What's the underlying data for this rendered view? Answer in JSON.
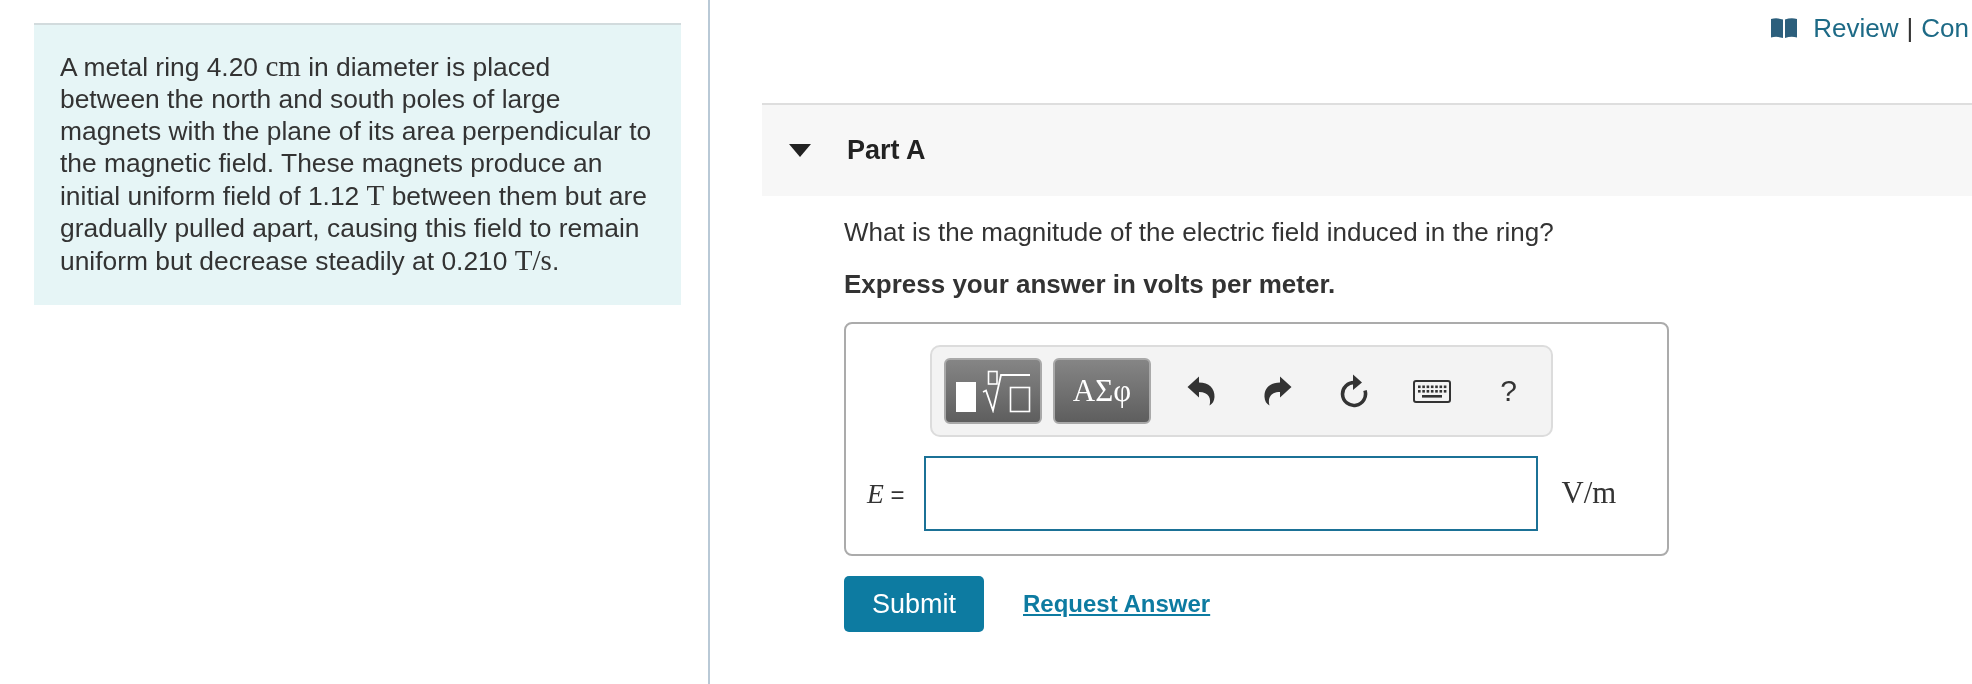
{
  "header": {
    "links": [
      {
        "label": "Review"
      },
      {
        "label": "Con"
      }
    ],
    "separator": "|"
  },
  "problem": {
    "segments": [
      {
        "kind": "text",
        "text": "A metal ring 4.20 "
      },
      {
        "kind": "math",
        "text": "cm"
      },
      {
        "kind": "text",
        "text": " in diameter is placed between the north and south poles of large magnets with the plane of its area perpendicular to the magnetic field. These magnets produce an initial uniform field of 1.12 "
      },
      {
        "kind": "math",
        "text": "T"
      },
      {
        "kind": "text",
        "text": " between them but are gradually pulled apart, causing this field to remain uniform but decrease steadily at 0.210 "
      },
      {
        "kind": "math",
        "text": "T/s"
      },
      {
        "kind": "text",
        "text": "."
      }
    ]
  },
  "parts": [
    {
      "title": "Part A",
      "expanded": true,
      "question": "What is the magnitude of the electric field induced in the ring?",
      "instruction": "Express your answer in volts per meter.",
      "toolbar": [
        {
          "kind": "templates"
        },
        {
          "kind": "symbols",
          "label": "ΑΣφ"
        },
        {
          "kind": "undo"
        },
        {
          "kind": "redo"
        },
        {
          "kind": "reset"
        },
        {
          "kind": "keyboard"
        },
        {
          "kind": "help",
          "label": "?"
        }
      ],
      "answer": {
        "label": [
          {
            "kind": "math-italic",
            "text": "E"
          },
          {
            "kind": "text",
            "text": " ="
          }
        ],
        "unit": [
          {
            "kind": "math",
            "text": "V/m"
          }
        ]
      },
      "actions": [
        {
          "kind": "submit",
          "label": "Submit"
        },
        {
          "kind": "link",
          "label": "Request Answer"
        }
      ]
    }
  ]
}
